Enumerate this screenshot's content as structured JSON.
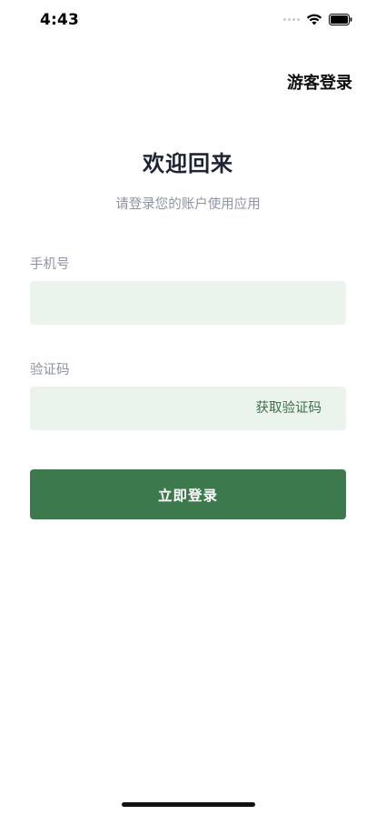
{
  "status_bar": {
    "time": "4:43"
  },
  "header": {
    "guest_login": "游客登录"
  },
  "main": {
    "title": "欢迎回来",
    "subtitle": "请登录您的账户使用应用",
    "phone_label": "手机号",
    "phone_value": "",
    "phone_placeholder": "",
    "code_label": "验证码",
    "code_value": "",
    "code_placeholder": "",
    "get_code": "获取验证码",
    "login_button": "立即登录"
  },
  "colors": {
    "accent": "#3c7a4d",
    "input_bg": "#ebf4ec",
    "link": "#3d6f49",
    "muted_text": "#8c93a4",
    "title_text": "#1e2433"
  }
}
